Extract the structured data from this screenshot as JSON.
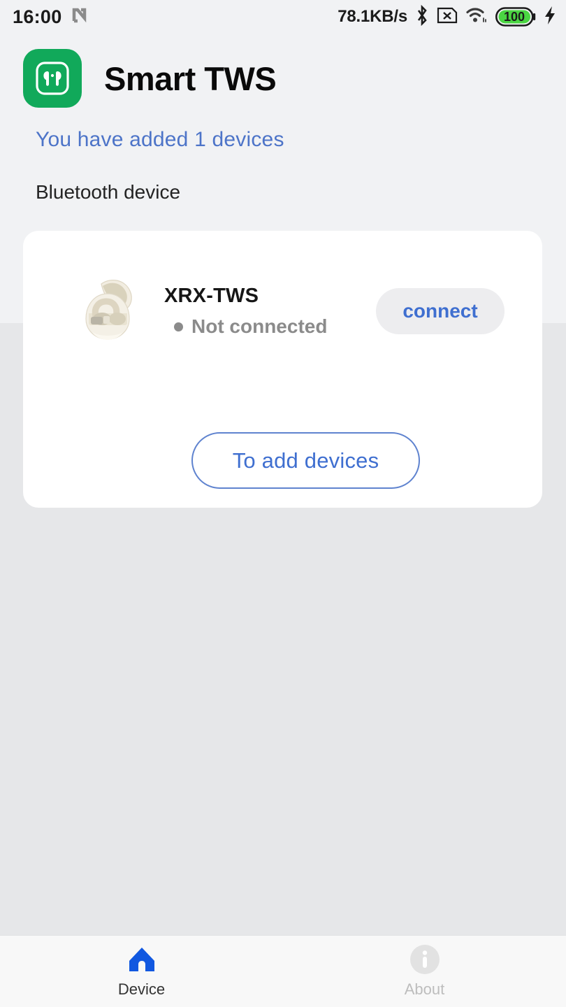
{
  "status_bar": {
    "time": "16:00",
    "nfc_icon": "nfc-icon",
    "network_speed": "78.1KB/s",
    "bluetooth_icon": "bluetooth-icon",
    "sim_icon": "sim-card-off-icon",
    "wifi_icon": "wifi-icon",
    "battery_level": "100",
    "charging_icon": "charging-bolt-icon"
  },
  "header": {
    "app_icon": "earbuds-app-icon",
    "title": "Smart TWS",
    "subtitle": "You have added 1 devices"
  },
  "section": {
    "label": "Bluetooth device"
  },
  "device": {
    "thumb_icon": "earbuds-case-image",
    "name": "XRX-TWS",
    "status": "Not connected",
    "status_dot": "status-dot-offline",
    "connect_label": "connect"
  },
  "actions": {
    "add_devices_label": "To add devices"
  },
  "bottom_nav": [
    {
      "icon": "home-icon",
      "label": "Device",
      "state": "active"
    },
    {
      "icon": "info-icon",
      "label": "About",
      "state": "inactive"
    }
  ],
  "colors": {
    "brand_green": "#11a95a",
    "accent_blue": "#3f6fd0",
    "subtitle_blue": "#4d74c8",
    "muted_gray": "#8b8b8b",
    "page_bg_top": "#f1f2f4",
    "page_bg_bottom": "#e6e7e9",
    "card_bg": "#ffffff",
    "battery_green": "#4ad642"
  }
}
